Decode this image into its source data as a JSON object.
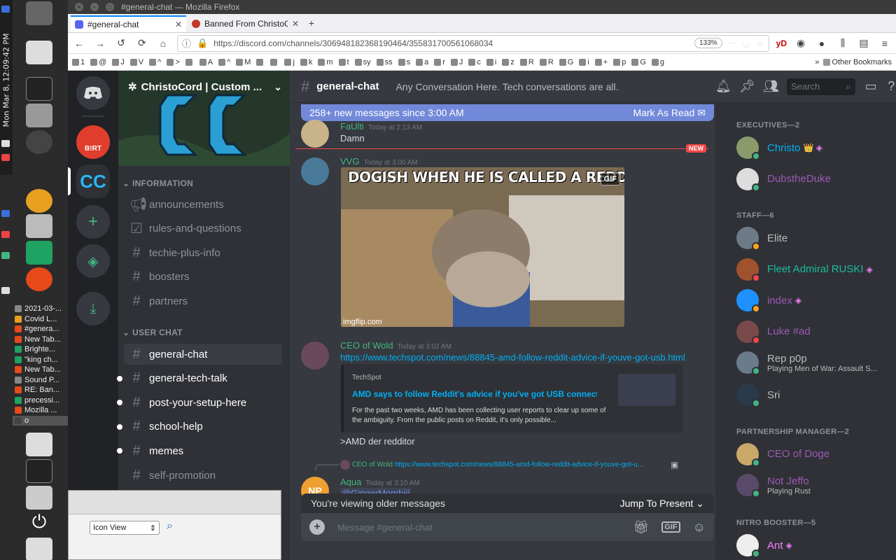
{
  "desktop": {
    "clock": "Mon Mar 8, 12:09:42 PM",
    "tasks": [
      {
        "label": "2021-03-...",
        "color": "#888888"
      },
      {
        "label": "Covid L...",
        "color": "#e6a020"
      },
      {
        "label": "#genera...",
        "color": "#e64a19"
      },
      {
        "label": "New Tab...",
        "color": "#e64a19"
      },
      {
        "label": "Brighte...",
        "color": "#1ea362"
      },
      {
        "label": "\"king ch...",
        "color": "#1ea362"
      },
      {
        "label": "New Tab...",
        "color": "#e64a19"
      },
      {
        "label": "Sound P...",
        "color": "#888888"
      },
      {
        "label": "RE: Ban...",
        "color": "#e64a19"
      },
      {
        "label": "precessi...",
        "color": "#1ea362"
      },
      {
        "label": "Mozilla ...",
        "color": "#e64a19"
      },
      {
        "label": "o",
        "color": "#444444"
      }
    ],
    "file_window": {
      "view_mode": "Icon View"
    }
  },
  "browser": {
    "window_title": "#general-chat — Mozilla Firefox",
    "tabs": [
      {
        "label": "#general-chat",
        "active": true
      },
      {
        "label": "Banned From ChristoCord",
        "active": false
      }
    ],
    "url": "https://discord.com/channels/306948182368190464/355831700561068034",
    "zoom": "133%",
    "toolbar_text": "yD",
    "bookmarks": [
      "1",
      "@",
      "J",
      "V",
      "^",
      ">",
      "",
      "A",
      "^",
      "M",
      "",
      "",
      "j",
      "k",
      "m",
      "t",
      "sy",
      "ss",
      "s",
      "a",
      "r",
      "J",
      "c",
      "i",
      "z",
      "R",
      "R",
      "G",
      "i",
      "+",
      "p",
      "G",
      "g"
    ],
    "other_bookmarks": "Other Bookmarks"
  },
  "discord": {
    "server_name": "ChristoCord | Custom ...",
    "server_logo": "CC",
    "guild_badge": "B!RT",
    "categories": {
      "info": "INFORMATION",
      "user": "USER CHAT"
    },
    "info_channels": [
      {
        "name": "announcements",
        "icon": "megaphone-icon"
      },
      {
        "name": "rules-and-questions",
        "icon": "checkbox-icon"
      },
      {
        "name": "techie-plus-info",
        "icon": "hash-icon"
      },
      {
        "name": "boosters",
        "icon": "hash-icon"
      },
      {
        "name": "partners",
        "icon": "hash-icon"
      }
    ],
    "user_channels": [
      {
        "name": "general-chat",
        "selected": true
      },
      {
        "name": "general-tech-talk",
        "unread": true
      },
      {
        "name": "post-your-setup-here",
        "unread": true
      },
      {
        "name": "school-help",
        "unread": true
      },
      {
        "name": "memes",
        "unread": true
      },
      {
        "name": "self-promotion",
        "unread": false
      }
    ],
    "chat": {
      "channel": "general-chat",
      "topic": "Any Conversation Here. Tech conversations are all...",
      "new_messages": "258+ new messages since 3:00 AM",
      "mark_read": "Mark As Read",
      "new_label": "NEW",
      "messages": {
        "m1": {
          "author": "FaUlti",
          "time": "Today at 2:13 AM",
          "text": "Damn",
          "color": "#43b581"
        },
        "m2": {
          "author": "VVG",
          "time": "Today at 3:00 AM",
          "color": "#43b581",
          "gif_caption": "DOGISH WHEN HE IS CALLED A REDDITOR",
          "gif_tag": "GIF",
          "gif_watermark": "imgflip.com"
        },
        "m3": {
          "author": "CEO of Wold",
          "time": "Today at 3:02 AM",
          "color": "#43b581",
          "link": "https://www.techspot.com/news/88845-amd-follow-reddit-advice-if-youve-got-usb.html",
          "embed_provider": "TechSpot",
          "embed_title": "AMD says to follow Reddit's advice if you've got USB connectivity i...",
          "embed_desc": "For the past two weeks, AMD has been collecting user reports to clear up some of the ambiguity. From the public posts on Reddit, it's only possible...",
          "text": ">AMD der redditor"
        },
        "m4": {
          "reply_author": "CEO of Wold",
          "reply_link": "https://www.techspot.com/news/88845-amd-follow-reddit-advice-if-youve-got-u...",
          "author": "Aqua",
          "time": "Today at 3:10 AM",
          "color": "#43b581",
          "mention": "@GingerMombiii",
          "avatar_text": "NP"
        }
      },
      "older_notice": "You're viewing older messages",
      "jump_label": "Jump To Present",
      "placeholder": "Message #general-chat",
      "gif_button": "GIF"
    },
    "search_placeholder": "Search",
    "member_groups": [
      {
        "title": "EXECUTIVES—2",
        "members": [
          {
            "name": "Christo",
            "color": "#00b0f4",
            "status": "#43b581",
            "avatar": "#8a9a6a",
            "badge": "👑 ◈"
          },
          {
            "name": "DubstheDuke",
            "color": "#9b59b6",
            "status": "#43b581",
            "avatar": "#dddddd",
            "badge": ""
          }
        ]
      },
      {
        "title": "STAFF—6",
        "members": [
          {
            "name": "Elite",
            "color": "#b9bbbe",
            "status": "#faa61a",
            "avatar": "#6d7a88",
            "badge": ""
          },
          {
            "name": "Fleet Admiral RUSKI",
            "color": "#1abc9c",
            "status": "#f04747",
            "avatar": "#a0522d",
            "badge": "◈"
          },
          {
            "name": "index",
            "color": "#9b59b6",
            "status": "#faa61a",
            "avatar": "#1e90ff",
            "badge": "◈"
          },
          {
            "name": "Luke #ad",
            "color": "#9b59b6",
            "status": "#f04747",
            "avatar": "#7a4a4a",
            "badge": ""
          },
          {
            "name": "Rep p0p",
            "color": "#b9bbbe",
            "status": "#43b581",
            "avatar": "#6a7b8c",
            "badge": "",
            "sub": "Playing Men of War: Assault S..."
          },
          {
            "name": "Sri",
            "color": "#b9bbbe",
            "status": "#43b581",
            "avatar": "#2a3a4a",
            "badge": ""
          }
        ]
      },
      {
        "title": "PARTNERSHIP MANAGER—2",
        "members": [
          {
            "name": "CEO of Doge",
            "color": "#9b59b6",
            "status": "#43b581",
            "avatar": "#c9a86a",
            "badge": ""
          },
          {
            "name": "Not Jeffo",
            "color": "#9b59b6",
            "status": "#43b581",
            "avatar": "#5a4a6a",
            "badge": "",
            "sub": "Playing Rust"
          }
        ]
      },
      {
        "title": "NITRO BOOSTER—5",
        "members": [
          {
            "name": "Ant",
            "color": "#f47fff",
            "status": "#43b581",
            "avatar": "#eeeeee",
            "badge": "◈"
          }
        ]
      }
    ]
  }
}
